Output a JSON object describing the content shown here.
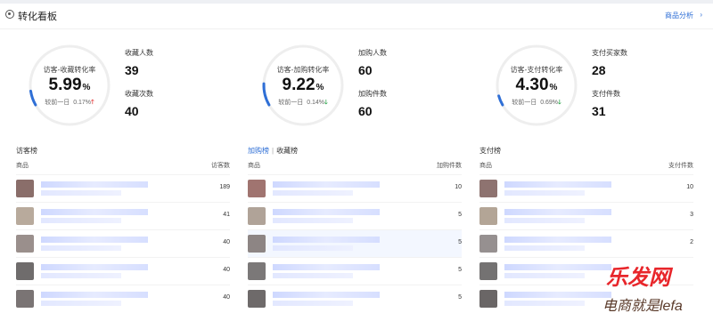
{
  "header": {
    "title": "转化看板",
    "link": "商品分析",
    "chevron": "›"
  },
  "metrics": [
    {
      "name": "访客-收藏转化率",
      "value": "5.99",
      "unit": "%",
      "compare_label": "较前一日",
      "compare_value": "0.17%",
      "trend": "up",
      "trend_glyph": "🡑",
      "ring_fraction": 0.06,
      "stats": [
        {
          "label": "收藏人数",
          "value": "39"
        },
        {
          "label": "收藏次数",
          "value": "40"
        }
      ]
    },
    {
      "name": "访客-加购转化率",
      "value": "9.22",
      "unit": "%",
      "compare_label": "较前一日",
      "compare_value": "0.14%",
      "trend": "down",
      "trend_glyph": "🡓",
      "ring_fraction": 0.09,
      "stats": [
        {
          "label": "加购人数",
          "value": "60"
        },
        {
          "label": "加购件数",
          "value": "60"
        }
      ]
    },
    {
      "name": "访客-支付转化率",
      "value": "4.30",
      "unit": "%",
      "compare_label": "较前一日",
      "compare_value": "0.69%",
      "trend": "down",
      "trend_glyph": "🡓",
      "ring_fraction": 0.04,
      "stats": [
        {
          "label": "支付买家数",
          "value": "28"
        },
        {
          "label": "支付件数",
          "value": "31"
        }
      ]
    }
  ],
  "panels": [
    {
      "title_main": "访客榜",
      "title_alt": "",
      "col_product": "商品",
      "col_metric": "访客数",
      "values": [
        "189",
        "41",
        "40",
        "40",
        "40"
      ]
    },
    {
      "title_main": "加购榜",
      "title_alt": "收藏榜",
      "col_product": "商品",
      "col_metric": "加购件数",
      "values": [
        "10",
        "5",
        "5",
        "5",
        "5"
      ]
    },
    {
      "title_main": "支付榜",
      "title_alt": "",
      "col_product": "商品",
      "col_metric": "支付件数",
      "values": [
        "10",
        "3",
        "2",
        "",
        ""
      ]
    }
  ],
  "watermark": {
    "brand": "乐发网",
    "sub": "电商就是lefa"
  },
  "colors": {
    "accent": "#2f6fd6",
    "ring_track": "#eeeeee",
    "ring_fill": "#2f6fd6",
    "up": "#e33b3b",
    "down": "#2aa44a"
  }
}
